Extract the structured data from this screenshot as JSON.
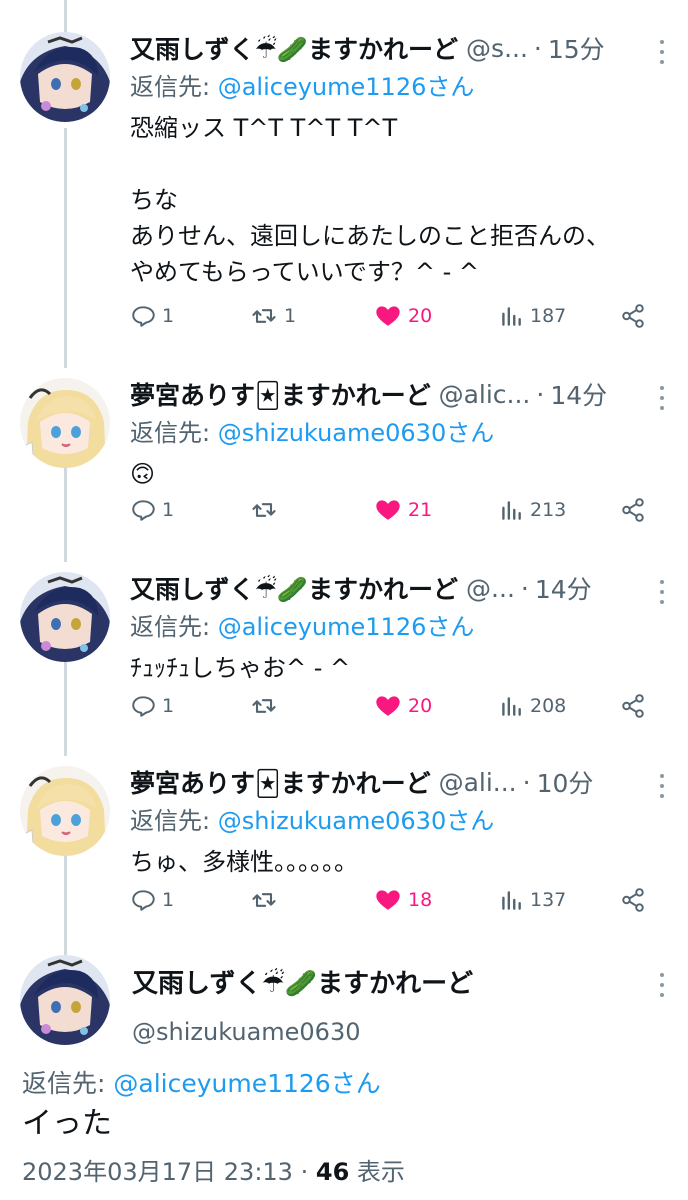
{
  "tweets": [
    {
      "name": "又雨しずく☔🥒ますかれーど",
      "handle": "@s...",
      "time": "15分",
      "reply_prefix": "返信先: ",
      "reply_to": "@aliceyume1126さん",
      "text": "恐縮ッス T^T T^T T^T\n\nちな\nありせん、遠回しにあたしのこと拒否んの、\nやめてもらっていいです？^ - ^",
      "replies": "1",
      "retweets": "1",
      "likes": "20",
      "views": "187",
      "avatar": "shizuku"
    },
    {
      "name": "夢宮ありす🃏ますかれーど",
      "handle": "@alic...",
      "time": "14分",
      "reply_prefix": "返信先: ",
      "reply_to": "@shizukuame0630さん",
      "text": "🙃",
      "replies": "1",
      "retweets": "",
      "likes": "21",
      "views": "213",
      "avatar": "alice"
    },
    {
      "name": "又雨しずく☔🥒ますかれーど",
      "handle": "@...",
      "time": "14分",
      "reply_prefix": "返信先: ",
      "reply_to": "@aliceyume1126さん",
      "text": "ﾁｭｯﾁｭしちゃお^ - ^",
      "replies": "1",
      "retweets": "",
      "likes": "20",
      "views": "208",
      "avatar": "shizuku"
    },
    {
      "name": "夢宮ありす🃏ますかれーど",
      "handle": "@ali...",
      "time": "10分",
      "reply_prefix": "返信先: ",
      "reply_to": "@shizukuame0630さん",
      "text": "ちゅ、多様性。。。。。。",
      "replies": "1",
      "retweets": "",
      "likes": "18",
      "views": "137",
      "avatar": "alice"
    }
  ],
  "main": {
    "name": "又雨しずく☔🥒ますかれーど",
    "handle": "@shizukuame0630",
    "reply_prefix": "返信先: ",
    "reply_to": "@aliceyume1126さん",
    "text": "イった",
    "timestamp": "2023年03月17日 23:13",
    "separator": "·",
    "views_count": "46",
    "views_label": "表示"
  },
  "colors": {
    "link": "#1d9bf0",
    "like": "#f91880",
    "muted": "#536471",
    "thread_line": "#cfd9de"
  }
}
